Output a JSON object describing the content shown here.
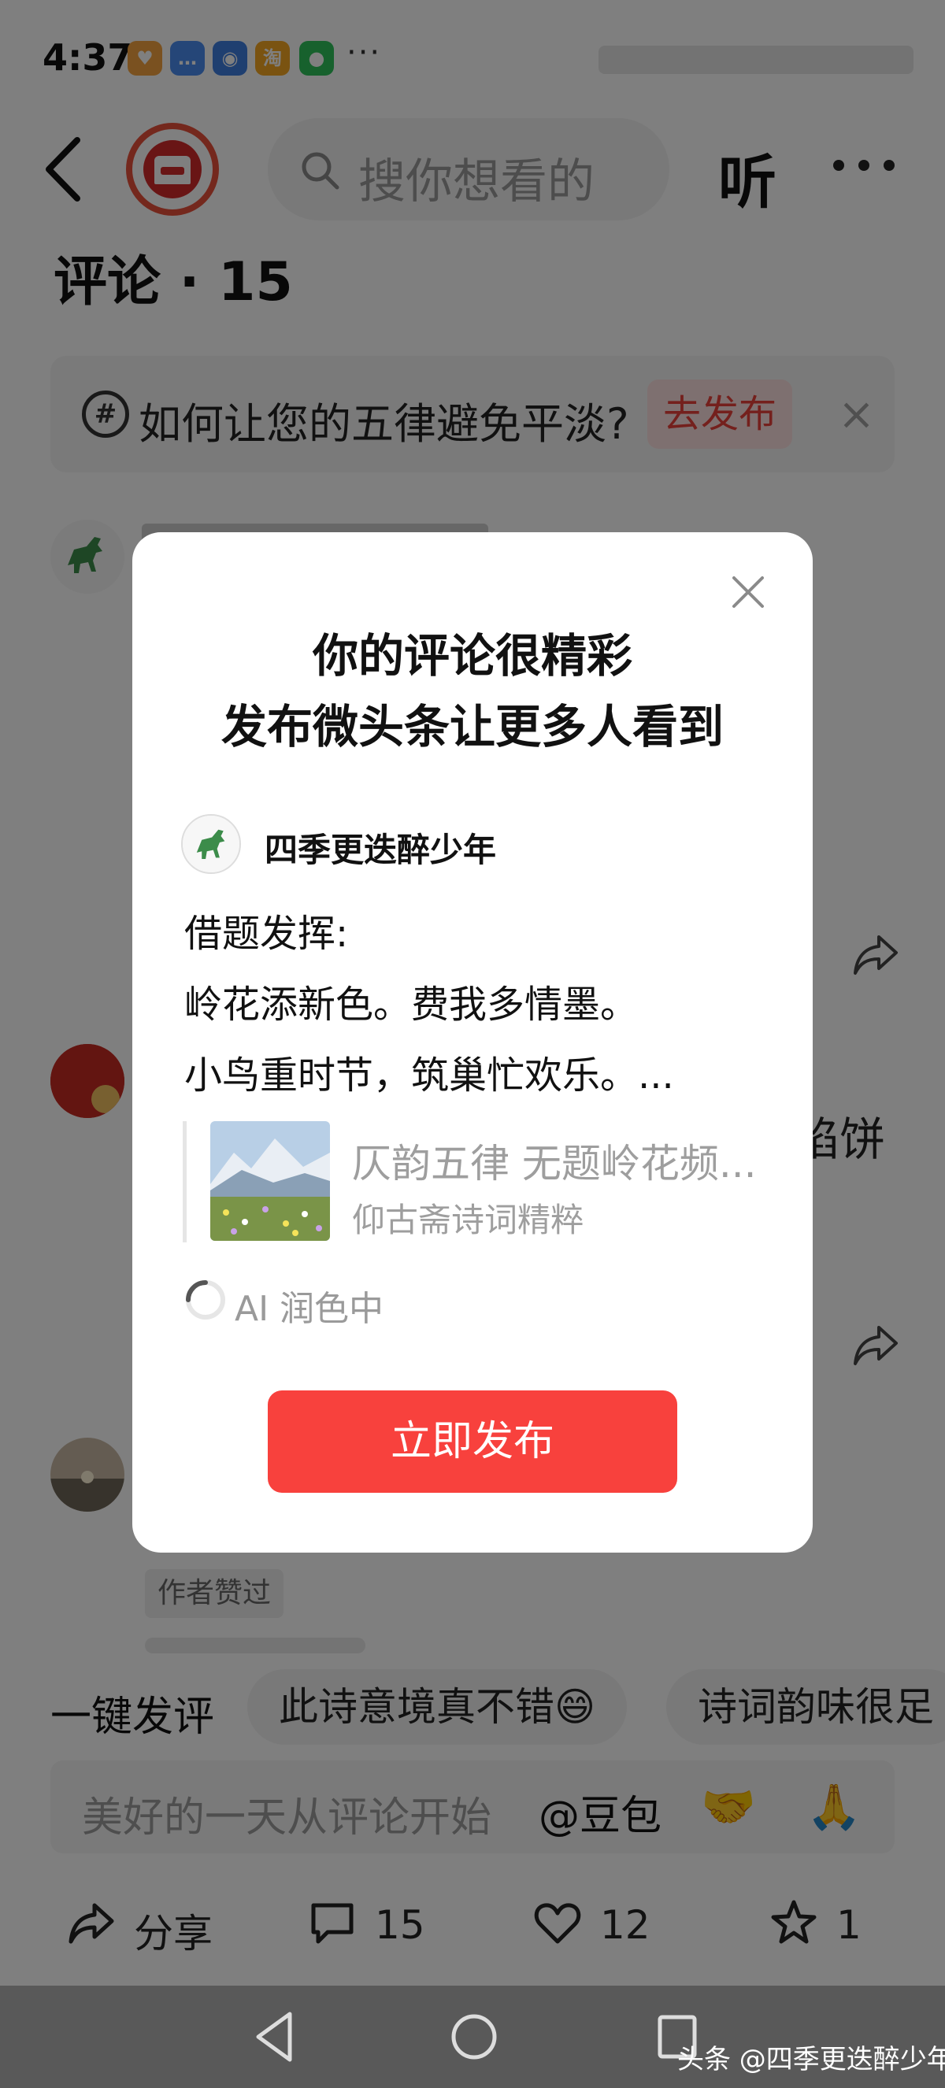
{
  "status_bar": {
    "time": "4:37",
    "more": "···",
    "apps": [
      {
        "icon": "heart-app-icon",
        "color": "#f4a340"
      },
      {
        "icon": "message-app-icon",
        "color": "#4a8cf0"
      },
      {
        "icon": "lightbulb-app-icon",
        "color": "#3f7ee0"
      },
      {
        "icon": "taobao-app-icon",
        "color": "#f5a623",
        "text": "淘"
      },
      {
        "icon": "wechat-app-icon",
        "color": "#2fc25b"
      }
    ]
  },
  "topbar": {
    "search_placeholder": "搜你想看的",
    "listen_label": "听"
  },
  "comments_header": {
    "title": "评论 · 15"
  },
  "topic": {
    "icon_glyph": "#",
    "text": "如何让您的五律避免平淡?",
    "button": "去发布",
    "close": "×"
  },
  "background_snippets": {
    "right_text": "馅饼"
  },
  "author_liked": "作者赞过",
  "quick_reply": {
    "label": "一键发评",
    "chips": [
      "此诗意境真不错😄",
      "诗词韵味很足"
    ]
  },
  "input_bar": {
    "placeholder": "美好的一天从评论开始",
    "mention": "@豆包",
    "emojis": [
      "🤝",
      "🙏"
    ]
  },
  "actions": {
    "share": "分享",
    "comments": "15",
    "likes": "12",
    "favorites": "1"
  },
  "watermark": "头条 @四季更迭醉少年",
  "modal": {
    "title_line1": "你的评论很精彩",
    "title_line2": "发布微头条让更多人看到",
    "author": "四季更迭醉少年",
    "post_lines": [
      "借题发挥:",
      "岭花添新色。费我多情墨。",
      "小鸟重时节，筑巢忙欢乐。..."
    ],
    "quote": {
      "title": "仄韵五律 无题岭花频...",
      "source": "仰古斋诗词精粹"
    },
    "ai_status": "AI 润色中",
    "publish_button": "立即发布"
  },
  "colors": {
    "accent_red": "#f8413d",
    "topic_btn_bg": "#fde1e0",
    "overlay": "rgba(0,0,0,0.5)"
  }
}
